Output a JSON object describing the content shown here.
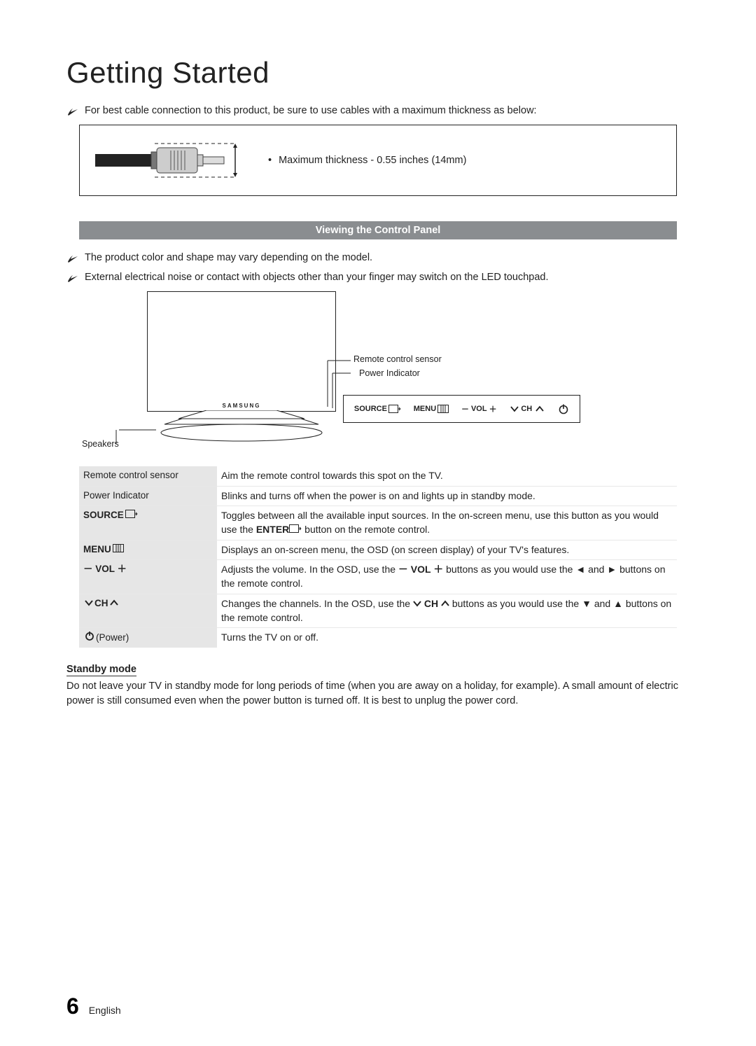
{
  "title": "Getting Started",
  "notes": {
    "cable": "For best cable connection to this product, be sure to use cables with a maximum thickness as below:",
    "thickness": "Maximum thickness - 0.55 inches (14mm)",
    "section_heading": "Viewing the Control Panel",
    "vary": "The product color and shape may vary depending on the model.",
    "noise": "External electrical noise or contact with objects other than your finger may switch on the LED touchpad."
  },
  "diagram": {
    "brand": "SAMSUNG",
    "remote_sensor": "Remote control sensor",
    "power_indicator": "Power Indicator",
    "speakers": "Speakers"
  },
  "panel": {
    "source": "SOURCE",
    "menu": "MENU",
    "vol_minus": "－",
    "vol": "VOL",
    "vol_plus": "＋",
    "ch": "CH"
  },
  "table": {
    "rows": [
      {
        "label": "Remote control sensor",
        "html": "Aim the remote control towards this spot on the TV."
      },
      {
        "label": "Power Indicator",
        "html": "Blinks and turns off when the power is on and lights up in standby mode."
      },
      {
        "label_html": "<span class='inlabel bold'>SOURCE <span class='inline-icon'><svg width='18' height='12' viewBox='0 0 18 12'><rect x='0.5' y='0.5' width='13' height='11' fill='none' stroke='#222'/><path d='M14 6 L17 6 M17 6 L15 4 M17 6 L15 8' stroke='#222' fill='none'/></svg></span></span>",
        "html": "Toggles between all the available input sources. In the on-screen menu, use this button as you would use the <span class='bold'>ENTER</span><span class='inline-icon'><svg width='18' height='12' viewBox='0 0 18 12'><rect x='0.5' y='0.5' width='13' height='11' fill='none' stroke='#222'/><path d='M14 6 L17 6 M17 6 L15 4 M17 6 L15 8' stroke='#222' fill='none'/></svg></span> button on the remote control."
      },
      {
        "label_html": "<span class='inlabel bold'>MENU <span class='inline-icon'><svg width='16' height='12' viewBox='0 0 16 12'><rect x='0.5' y='0.5' width='15' height='11' fill='none' stroke='#222'/><line x1='5' y1='0.5' x2='5' y2='11.5' stroke='#222'/><line x1='8' y1='0.5' x2='8' y2='11.5' stroke='#222'/><line x1='11' y1='0.5' x2='11' y2='11.5' stroke='#222'/></svg></span></span>",
        "html": "Displays an on-screen menu, the OSD (on screen display) of your TV's features."
      },
      {
        "label_html": "<span class='inlabel bold'>－ VOL ＋</span>",
        "html": "Adjusts the volume. In the OSD, use the <span class='bold'>－ VOL ＋</span> buttons as you would use the ◄ and ► buttons on the remote control."
      },
      {
        "label_html": "<span class='inlabel bold'><span class='inline-icon'><svg width='12' height='10' viewBox='0 0 12 10'><path d='M1 2 L6 8 L11 2' stroke='#222' stroke-width='2' fill='none'/></svg></span> CH <span class='inline-icon'><svg width='12' height='10' viewBox='0 0 12 10'><path d='M1 8 L6 2 L11 8' stroke='#222' stroke-width='2' fill='none'/></svg></span></span>",
        "html": "Changes the channels. In the OSD, use the <span class='bold inline-icon'><svg width='12' height='10' viewBox='0 0 12 10'><path d='M1 2 L6 8 L11 2' stroke='#222' stroke-width='2' fill='none'/></svg></span> <span class='bold'>CH</span> <span class='bold inline-icon'><svg width='12' height='10' viewBox='0 0 12 10'><path d='M1 8 L6 2 L11 8' stroke='#222' stroke-width='2' fill='none'/></svg></span> buttons as you would use the ▼ and ▲ buttons on the remote control."
      },
      {
        "label_html": "<span class='inlabel'><span class='inline-icon'><svg width='14' height='14' viewBox='0 0 14 14'><circle cx='7' cy='8' r='5' fill='none' stroke='#222' stroke-width='1.8'/><line x1='7' y1='1' x2='7' y2='7' stroke='#222' stroke-width='1.8'/></svg></span> (Power)</span>",
        "html": "Turns the TV on or off."
      }
    ]
  },
  "standby": {
    "heading": "Standby mode",
    "text": "Do not leave your TV in standby mode for long periods of time (when you are away on a holiday, for example). A small amount of electric power is still consumed even when the power button is turned off. It is best to unplug the power cord."
  },
  "footer": {
    "page": "6",
    "lang": "English"
  }
}
